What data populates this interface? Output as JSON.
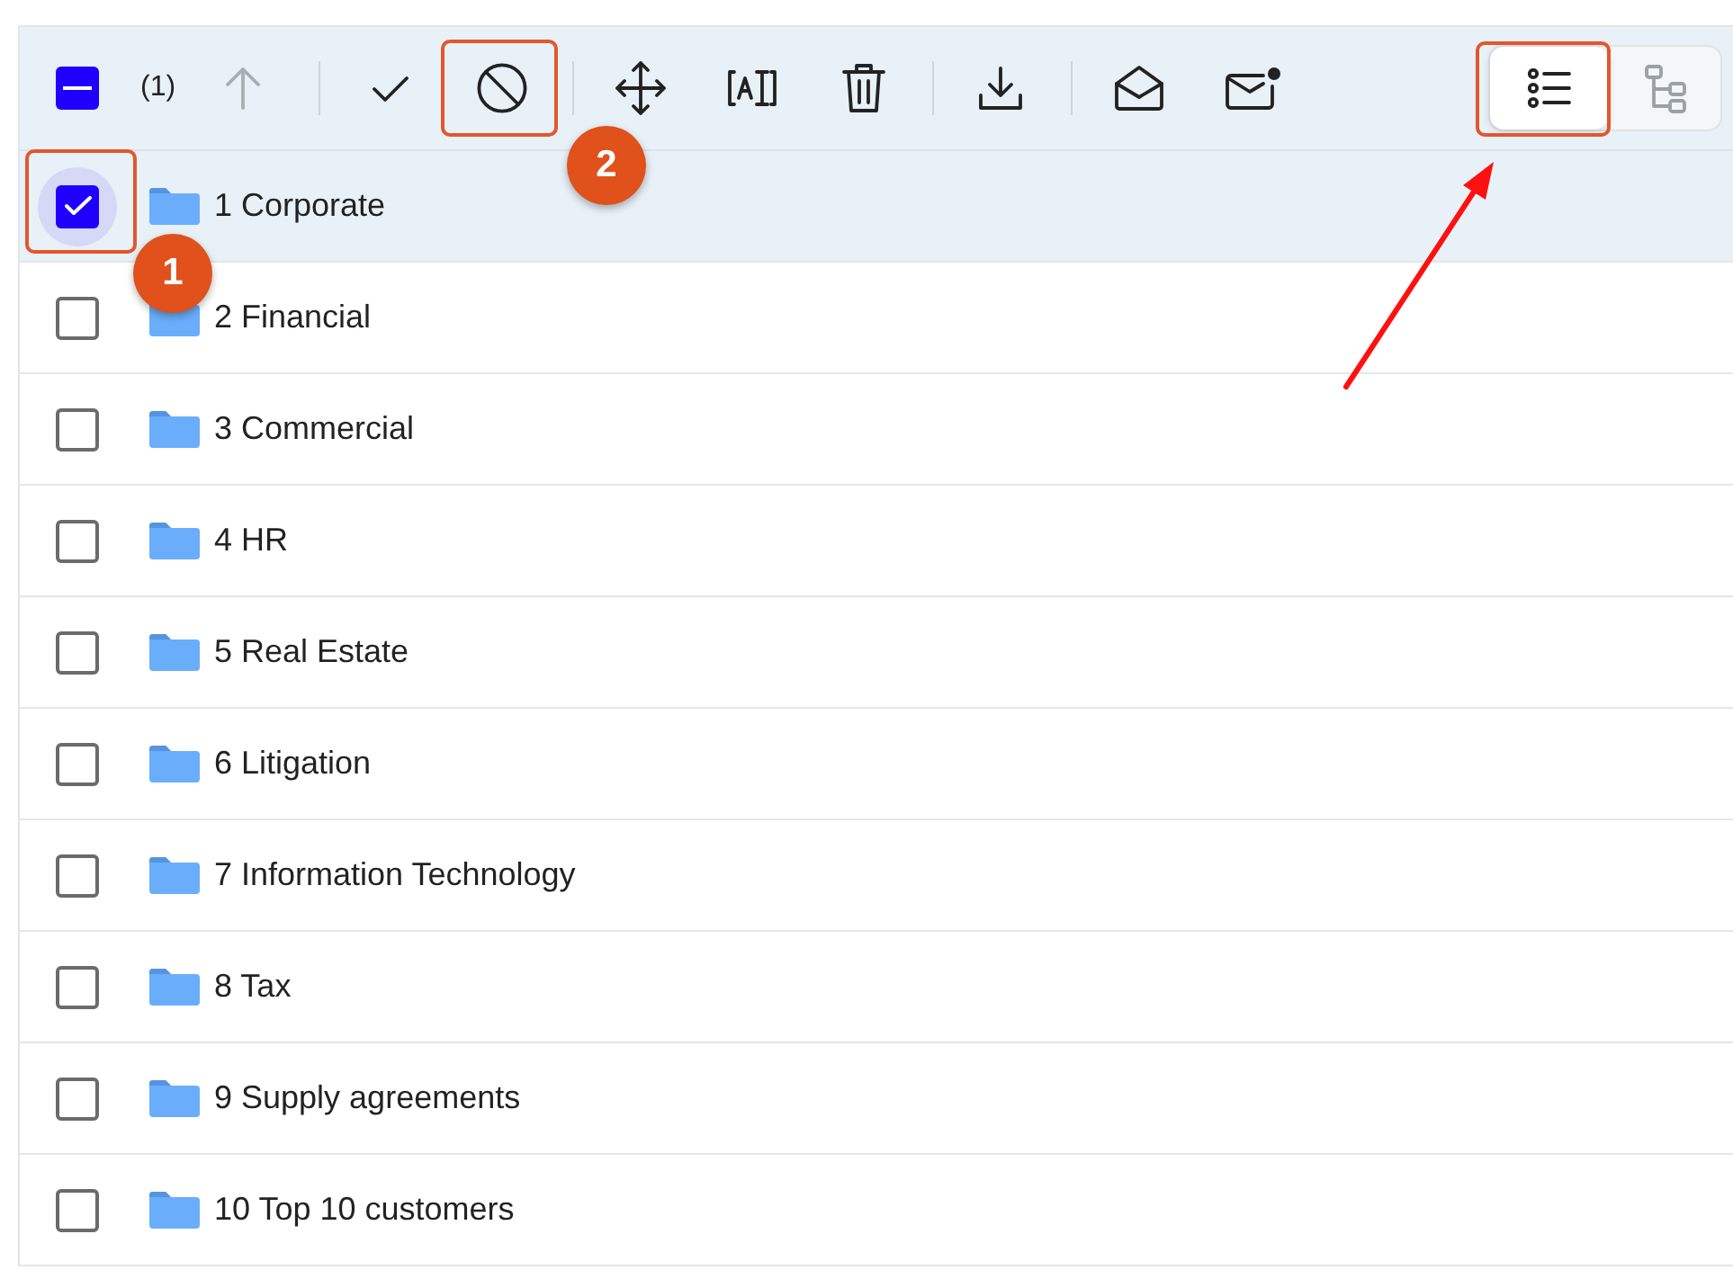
{
  "toolbar": {
    "select_all": {
      "indeterminate": true
    },
    "selection_count": "(1)",
    "buttons": [
      {
        "disabled": true
      },
      {
        "disabled": false
      },
      {
        "disabled": false
      },
      {
        "disabled": false
      },
      {
        "disabled": false
      },
      {
        "disabled": false
      },
      {
        "disabled": false
      },
      {
        "disabled": false
      },
      {
        "disabled": false
      }
    ],
    "view_modes": [
      {
        "selected": true
      },
      {
        "selected": false
      }
    ]
  },
  "folders": [
    {
      "name": "1 Corporate",
      "checked": true,
      "selected": true
    },
    {
      "name": "2 Financial",
      "checked": false,
      "selected": false
    },
    {
      "name": "3 Commercial",
      "checked": false,
      "selected": false
    },
    {
      "name": "4 HR",
      "checked": false,
      "selected": false
    },
    {
      "name": "5 Real Estate",
      "checked": false,
      "selected": false
    },
    {
      "name": "6 Litigation",
      "checked": false,
      "selected": false
    },
    {
      "name": "7 Information Technology",
      "checked": false,
      "selected": false
    },
    {
      "name": "8 Tax",
      "checked": false,
      "selected": false
    },
    {
      "name": "9 Supply agreements",
      "checked": false,
      "selected": false
    },
    {
      "name": "10 Top 10 customers",
      "checked": false,
      "selected": false
    }
  ],
  "annotations": [
    {
      "label": "1"
    },
    {
      "label": "2"
    }
  ]
}
